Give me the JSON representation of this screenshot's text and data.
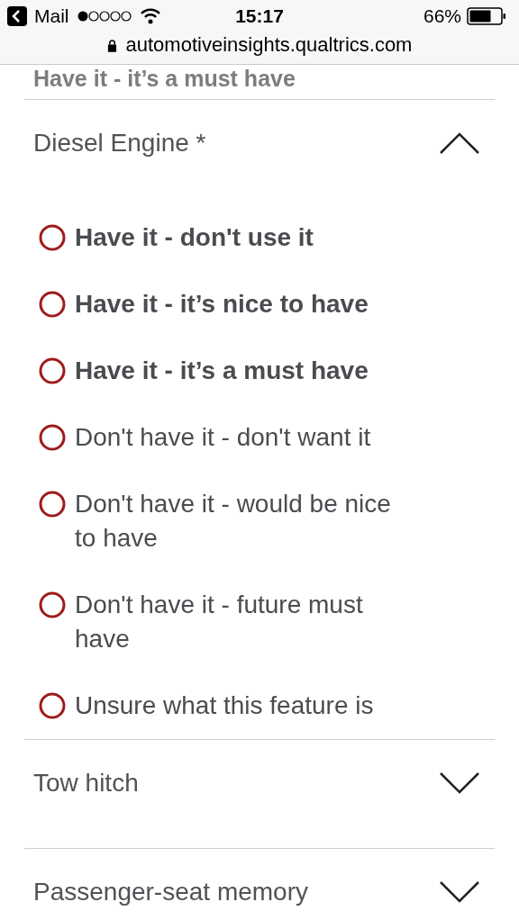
{
  "status_bar": {
    "back_app": "Mail",
    "time": "15:17",
    "battery": "66%"
  },
  "address_bar": {
    "url": "automotiveinsights.qualtrics.com"
  },
  "previous_answer": "Have it - it’s a must have",
  "sections": [
    {
      "title": "Diesel Engine *",
      "expanded": true,
      "options": [
        {
          "label": "Have it - don't use it",
          "bold": true,
          "selected": false
        },
        {
          "label": "Have it - it’s nice to have",
          "bold": true,
          "selected": false
        },
        {
          "label": "Have it - it’s a must have",
          "bold": true,
          "selected": false
        },
        {
          "label": "Don't have it - don't want it",
          "bold": false,
          "selected": false
        },
        {
          "label": "Don't have it - would be nice to have",
          "bold": false,
          "selected": false
        },
        {
          "label": "Don't have it - future must have",
          "bold": false,
          "selected": false
        },
        {
          "label": "Unsure what this feature is",
          "bold": false,
          "selected": false
        }
      ]
    },
    {
      "title": "Tow hitch",
      "expanded": false
    },
    {
      "title": "Passenger-seat memory",
      "expanded": false
    }
  ]
}
